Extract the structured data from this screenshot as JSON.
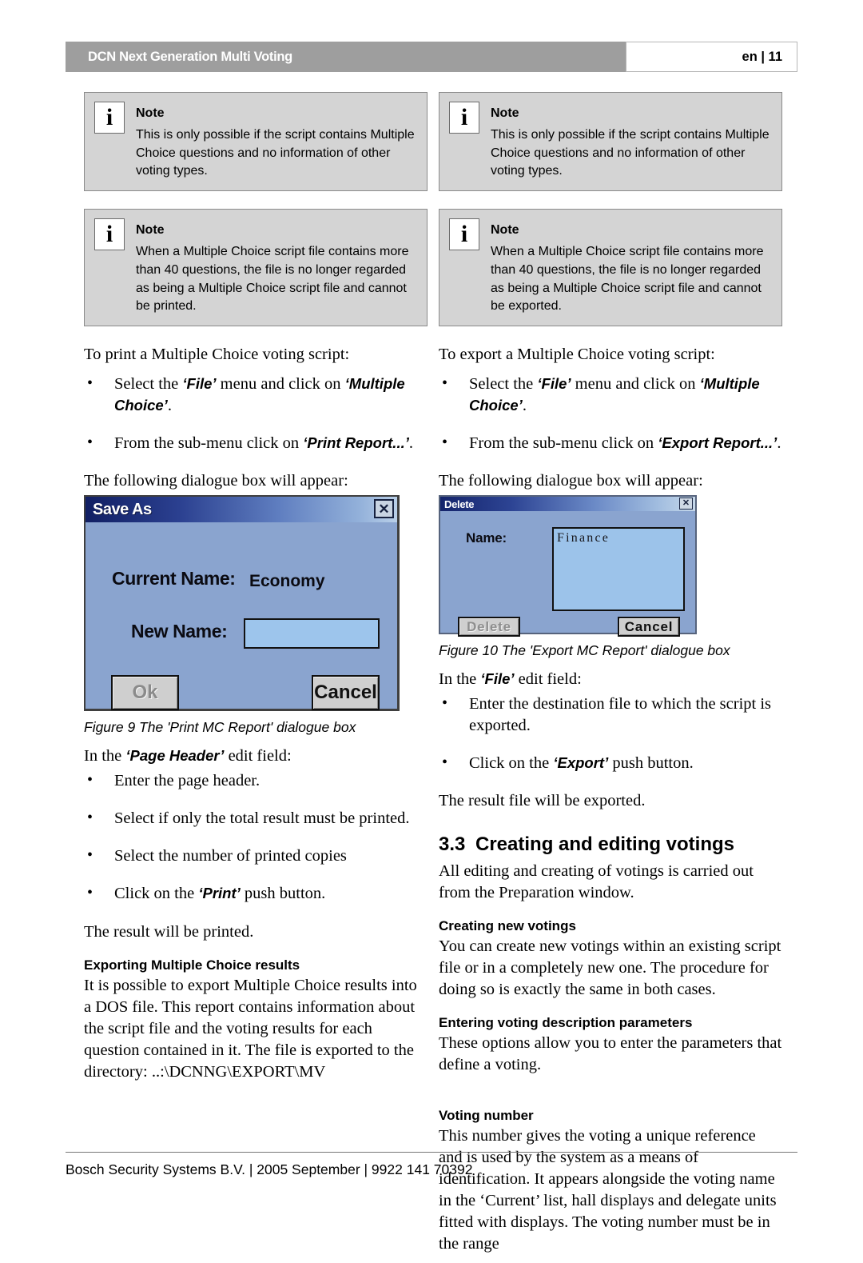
{
  "header": {
    "title": "DCN Next Generation Multi Voting",
    "page_label": "en | 11"
  },
  "notes": {
    "left_top": {
      "icon": "info-icon",
      "title": "Note",
      "text": "This is only possible if the script contains Multiple Choice questions and no information of other voting types."
    },
    "left_bottom": {
      "icon": "info-icon",
      "title": "Note",
      "text": "When a Multiple Choice script file contains more than 40 questions, the file is no longer regarded as being a Multiple Choice script file and cannot be printed."
    },
    "right_top": {
      "icon": "info-icon",
      "title": "Note",
      "text": "This is only possible if the script contains Multiple Choice questions and no information of other voting types."
    },
    "right_bottom": {
      "icon": "info-icon",
      "title": "Note",
      "text": "When a Multiple Choice script file contains more than 40 questions, the file is no longer regarded as being a Multiple Choice script file and cannot be exported."
    }
  },
  "left_column": {
    "intro": "To print a Multiple Choice voting script:",
    "bullet1_pre": "Select the ",
    "bullet1_term1": "‘File’",
    "bullet1_mid": " menu and click on ",
    "bullet1_term2": "‘Multiple Choice’",
    "bullet1_post": ".",
    "bullet2_pre": "From the sub-menu click on ",
    "bullet2_term": "‘Print Report...’",
    "bullet2_post": ".",
    "dialog_lead": "The following dialogue box will appear:",
    "figure_caption": "Figure 9 The 'Print MC Report' dialogue box",
    "edit_field_pre": "In the ",
    "edit_field_term": "‘Page Header’",
    "edit_field_post": " edit field:",
    "bullet3": "Enter the page header.",
    "bullet4": "Select if only the total result must be printed.",
    "bullet5": "Select the number of printed copies",
    "bullet6_pre": "Click on the ",
    "bullet6_term": "‘Print’",
    "bullet6_post": " push button.",
    "result_text": "The result will be printed.",
    "export_heading": "Exporting Multiple Choice results",
    "export_body": "It is possible to export Multiple Choice results into a DOS file. This report contains information about the script file and the voting results for each question contained in it. The file is exported to the directory: ..:\\DCNNG\\EXPORT\\MV"
  },
  "right_column": {
    "intro": "To export a Multiple Choice voting script:",
    "bullet1_pre": "Select the ",
    "bullet1_term1": "‘File’",
    "bullet1_mid": " menu and click on ",
    "bullet1_term2": "‘Multiple Choice’",
    "bullet1_post": ".",
    "bullet2_pre": "From the sub-menu click on ",
    "bullet2_term": "‘Export Report...’",
    "bullet2_post": ".",
    "dialog_lead": "The following dialogue box will appear:",
    "figure_caption": "Figure 10 The 'Export MC Report' dialogue box",
    "edit_field_pre": "In the ",
    "edit_field_term": "‘File’",
    "edit_field_post": " edit field:",
    "bullet3": "Enter the destination file to which the script is exported.",
    "bullet4_pre": "Click on the ",
    "bullet4_term": "‘Export’",
    "bullet4_post": " push button.",
    "result_text": "The result file will be exported.",
    "section_number": "3.3",
    "section_title": "Creating and editing votings",
    "section_body": "All editing and creating of votings is carried out from the Preparation window.",
    "sub1_heading": "Creating new votings",
    "sub1_body": "You can create new votings within an existing script file or in a completely new one. The procedure for doing so is exactly the same in both cases.",
    "sub2_heading": "Entering voting description parameters",
    "sub2_body": "These options allow you to enter the parameters that define a voting.",
    "sub3_heading": "Voting number",
    "sub3_body": "This number gives the voting a unique reference and is used by the system as a means of identification. It appears alongside the voting name in the ‘Current’ list, hall displays and delegate units fitted with displays. The voting number must be in the range"
  },
  "saveas_dialog": {
    "title": "Save As",
    "close_label": "✕",
    "current_name_label": "Current Name:",
    "current_name_value": "Economy",
    "new_name_label": "New Name:",
    "new_name_value": "",
    "ok_label": "Ok",
    "cancel_label": "Cancel"
  },
  "delete_dialog": {
    "title": "Delete",
    "close_label": "✕",
    "name_label": "Name:",
    "list_items": [
      "Finance"
    ],
    "delete_label": "Delete",
    "cancel_label": "Cancel"
  },
  "footer": {
    "text": "Bosch Security Systems B.V. | 2005 September | 9922 141 70392"
  },
  "colors": {
    "header_bar": "#9e9e9e",
    "note_bg": "#d4d4d4",
    "dialog_face": "#8aa4cf",
    "dialog_input": "#9dc5ec"
  }
}
